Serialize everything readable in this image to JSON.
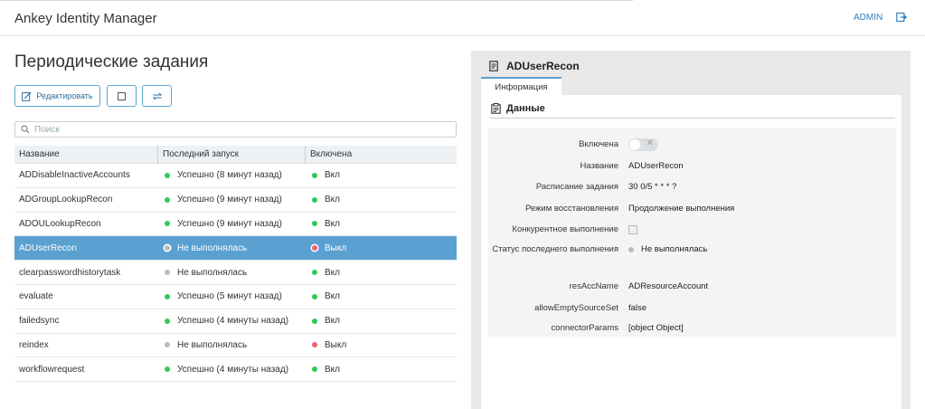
{
  "header": {
    "app_title": "Ankey Identity Manager",
    "user": "ADMIN",
    "logout_icon": "logout-icon"
  },
  "page": {
    "title": "Периодические задания"
  },
  "toolbar": {
    "edit_label": "Редактировать",
    "edit_icon": "edit-icon",
    "toggle_icon": "square-icon",
    "sync_icon": "refresh-icon"
  },
  "search": {
    "placeholder": "Поиск",
    "value": ""
  },
  "table": {
    "columns": [
      "Название",
      "Последний запуск",
      "Включена"
    ],
    "rows": [
      {
        "name": "ADDisableInactiveAccounts",
        "last_run": "Успешно (8 минут назад)",
        "last_run_status": "green",
        "enabled": "Вкл",
        "enabled_status": "green"
      },
      {
        "name": "ADGroupLookupRecon",
        "last_run": "Успешно (9 минут назад)",
        "last_run_status": "green",
        "enabled": "Вкл",
        "enabled_status": "green"
      },
      {
        "name": "ADOULookupRecon",
        "last_run": "Успешно (9 минут назад)",
        "last_run_status": "green",
        "enabled": "Вкл",
        "enabled_status": "green"
      },
      {
        "name": "ADUserRecon",
        "last_run": "Не выполнялась",
        "last_run_status": "grey",
        "enabled": "Выкл",
        "enabled_status": "red",
        "selected": true
      },
      {
        "name": "clearpasswordhistorytask",
        "last_run": "Не выполнялась",
        "last_run_status": "grey",
        "enabled": "Вкл",
        "enabled_status": "green"
      },
      {
        "name": "evaluate",
        "last_run": "Успешно (5 минут назад)",
        "last_run_status": "green",
        "enabled": "Вкл",
        "enabled_status": "green"
      },
      {
        "name": "failedsync",
        "last_run": "Успешно (4 минуты назад)",
        "last_run_status": "green",
        "enabled": "Вкл",
        "enabled_status": "green"
      },
      {
        "name": "reindex",
        "last_run": "Не выполнялась",
        "last_run_status": "grey",
        "enabled": "Выкл",
        "enabled_status": "red"
      },
      {
        "name": "workflowrequest",
        "last_run": "Успешно (4 минуты назад)",
        "last_run_status": "green",
        "enabled": "Вкл",
        "enabled_status": "green"
      }
    ]
  },
  "detail": {
    "title": "ADUserRecon",
    "title_icon": "document-icon",
    "tab": "Информация",
    "section": "Данные",
    "section_icon": "clipboard-icon",
    "fields": [
      {
        "label": "Включена",
        "type": "toggle",
        "value": "off"
      },
      {
        "label": "Название",
        "type": "text",
        "value": "ADUserRecon"
      },
      {
        "label": "Расписание задания",
        "type": "text",
        "value": "30 0/5 * * * ?"
      },
      {
        "label": "Режим восстановления",
        "type": "text",
        "value": "Продолжение выполнения"
      },
      {
        "label": "Конкурентное выполнение",
        "type": "checkbox",
        "value": "unchecked"
      },
      {
        "label": "Статус последнего выполнения",
        "type": "status",
        "value": "Не выполнялась"
      },
      {
        "label": "resAccName",
        "type": "text",
        "value": "ADResourceAccount"
      },
      {
        "label": "allowEmptySourceSet",
        "type": "text",
        "value": "false"
      },
      {
        "label": "connectorParams",
        "type": "text",
        "value": "[object Object]"
      }
    ]
  },
  "colors": {
    "accent": "#5aa0d0",
    "link": "#2f7fc1",
    "ok": "#2ecc55",
    "off": "#f06070",
    "none": "#b8bcc0"
  }
}
